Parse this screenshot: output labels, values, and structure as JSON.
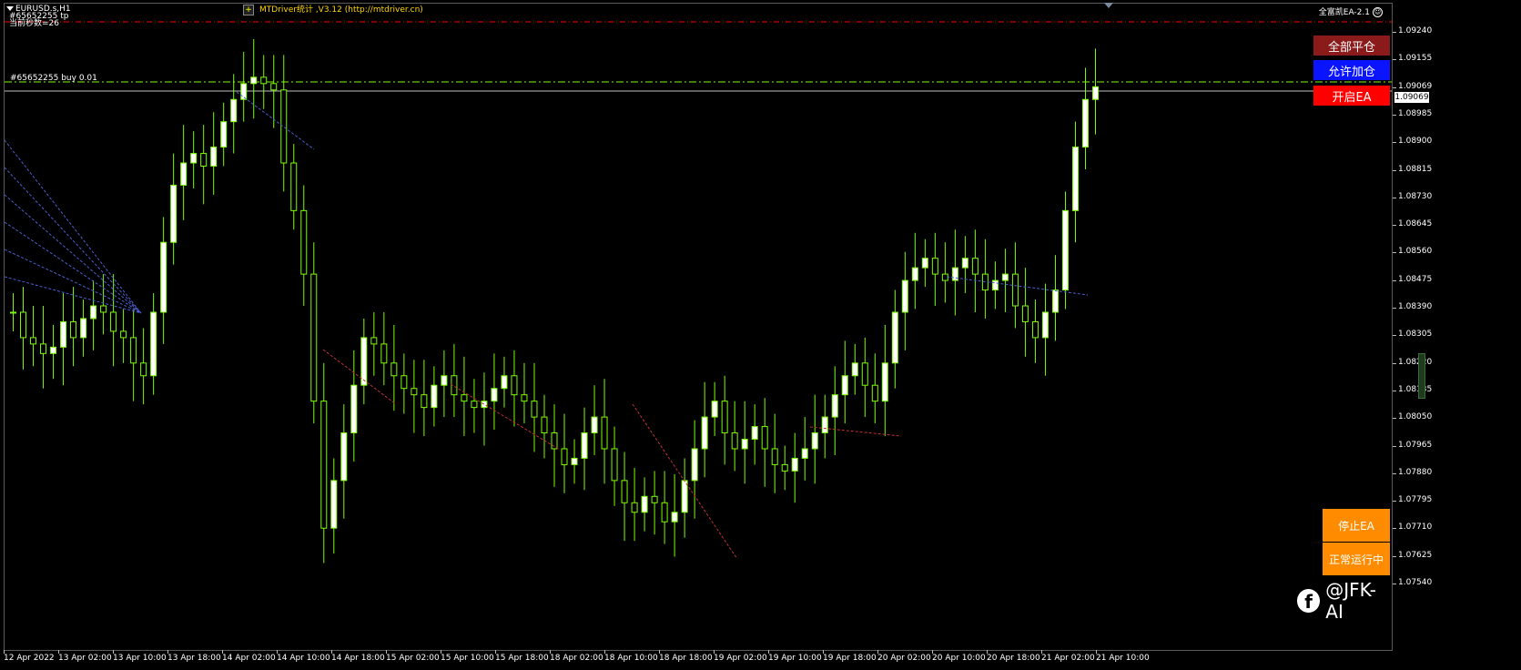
{
  "chart": {
    "symbol_timeframe": "EURUSD.s,H1",
    "order_line_1": "#65652255 tp",
    "order_line_2": "当前秒数=26",
    "indicator_title": "MTDriver统计 ,V3.12 (http://mtdriver.cn)",
    "ea_name": "全富凯EA-2.1",
    "smiley_icon": "smiley-icon",
    "position_label": "#65652255 buy 0.01",
    "current_price": "1.09069"
  },
  "buttons": {
    "close_all": "全部平仓",
    "allow_add": "允许加仓",
    "start_ea": "开启EA",
    "stop_ea": "停止EA",
    "running": "正常运行中"
  },
  "watermark": {
    "icon": "facebook-icon",
    "text": "@JFK-AI"
  },
  "colors": {
    "background": "#000000",
    "bull_candle": "#ffffff",
    "candle_outline": "#7cfc00",
    "tp_line": "#ff0000",
    "position_line": "#7cfc00",
    "button_red": "#ff0000",
    "button_blue": "#0a14ff",
    "button_darkred": "#8b1a1a",
    "button_orange": "#ff8c00"
  },
  "chart_data": {
    "type": "candlestick",
    "y_ticks": [
      "1.09240",
      "1.09155",
      "1.09069",
      "1.08985",
      "1.08900",
      "1.08815",
      "1.08730",
      "1.08645",
      "1.08560",
      "1.08475",
      "1.08390",
      "1.08305",
      "1.08220",
      "1.08135",
      "1.08050",
      "1.07965",
      "1.07880",
      "1.07795",
      "1.07710",
      "1.07625",
      "1.07540"
    ],
    "x_ticks": [
      "12 Apr 2022",
      "13 Apr 02:00",
      "13 Apr 10:00",
      "13 Apr 18:00",
      "14 Apr 02:00",
      "14 Apr 10:00",
      "14 Apr 18:00",
      "15 Apr 02:00",
      "15 Apr 10:00",
      "15 Apr 18:00",
      "18 Apr 02:00",
      "18 Apr 10:00",
      "18 Apr 18:00",
      "19 Apr 02:00",
      "19 Apr 10:00",
      "19 Apr 18:00",
      "20 Apr 02:00",
      "20 Apr 10:00",
      "20 Apr 18:00",
      "21 Apr 02:00",
      "21 Apr 10:00"
    ],
    "ylim": [
      1.0754,
      1.0926
    ],
    "tp_price": 1.0926,
    "position_price": 1.0909,
    "close_series": [
      1.0838,
      1.083,
      1.0828,
      1.0825,
      1.0827,
      1.0835,
      1.083,
      1.0836,
      1.084,
      1.0838,
      1.0832,
      1.083,
      1.0822,
      1.0818,
      1.0838,
      1.086,
      1.0878,
      1.0885,
      1.0888,
      1.0884,
      1.089,
      1.0898,
      1.0905,
      1.091,
      1.0912,
      1.091,
      1.0908,
      1.0885,
      1.087,
      1.085,
      1.081,
      1.077,
      1.0785,
      1.08,
      1.0815,
      1.083,
      1.0828,
      1.0822,
      1.0818,
      1.0814,
      1.0812,
      1.0808,
      1.0815,
      1.0818,
      1.0812,
      1.081,
      1.0808,
      1.081,
      1.0814,
      1.0818,
      1.0812,
      1.081,
      1.0805,
      1.08,
      1.0795,
      1.079,
      1.0792,
      1.08,
      1.0805,
      1.0795,
      1.0785,
      1.0778,
      1.0775,
      1.078,
      1.0778,
      1.0772,
      1.0775,
      1.0785,
      1.0795,
      1.0805,
      1.081,
      1.08,
      1.0795,
      1.0798,
      1.0802,
      1.0795,
      1.079,
      1.0788,
      1.0792,
      1.0795,
      1.08,
      1.0805,
      1.0812,
      1.0818,
      1.0822,
      1.0815,
      1.081,
      1.0822,
      1.0838,
      1.0848,
      1.0852,
      1.0855,
      1.085,
      1.0848,
      1.0852,
      1.0855,
      1.085,
      1.0845,
      1.0848,
      1.085,
      1.084,
      1.0835,
      1.083,
      1.0838,
      1.0845,
      1.087,
      1.089,
      1.0905,
      1.0909
    ]
  }
}
